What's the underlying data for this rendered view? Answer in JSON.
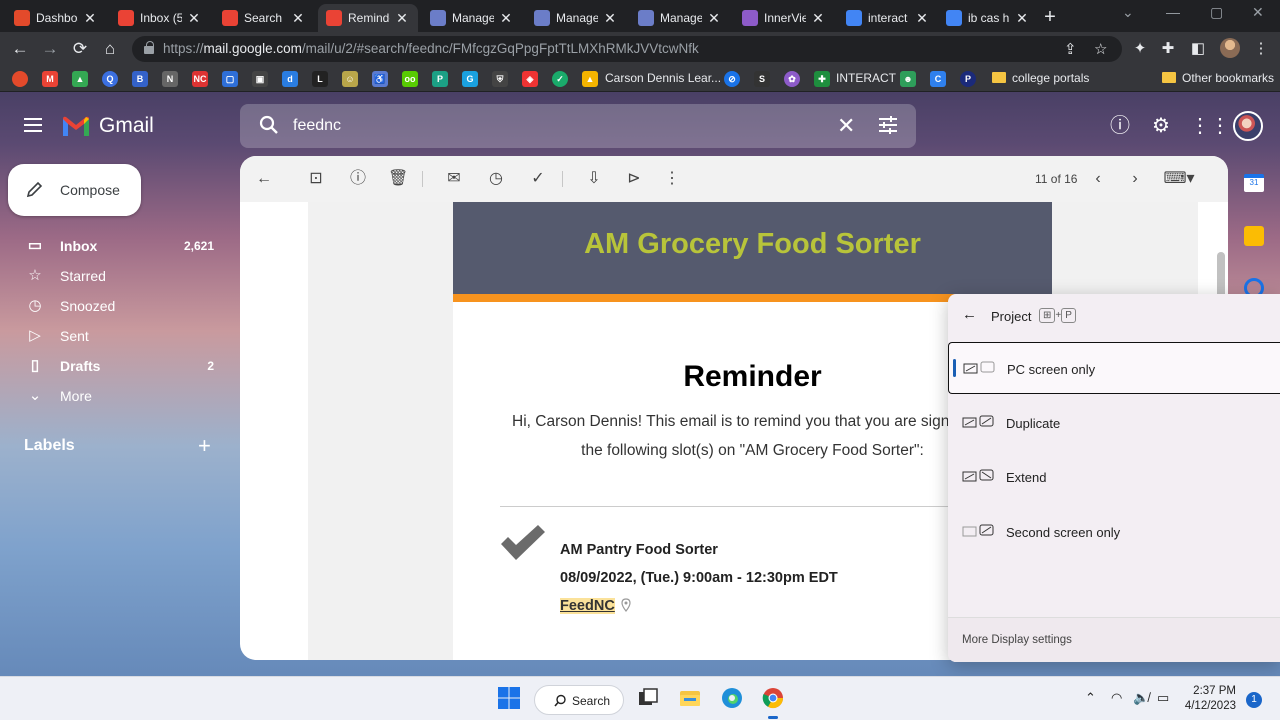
{
  "browser": {
    "tabs": [
      {
        "title": "Dashboa",
        "favicon": "canvas-icon",
        "color": "#e34a2b"
      },
      {
        "title": "Inbox (5",
        "favicon": "gmail-icon",
        "color": "#ea4335"
      },
      {
        "title": "Search r",
        "favicon": "gmail-icon",
        "color": "#ea4335"
      },
      {
        "title": "Reminde",
        "favicon": "gmail-icon",
        "color": "#ea4335",
        "active": true
      },
      {
        "title": "Manage",
        "favicon": "signup-icon",
        "color": "#6b7dc8"
      },
      {
        "title": "Manage",
        "favicon": "signup-icon",
        "color": "#6b7dc8"
      },
      {
        "title": "Manage",
        "favicon": "signup-icon",
        "color": "#6b7dc8"
      },
      {
        "title": "InnerVie",
        "favicon": "innerview-icon",
        "color": "#8d5bc9"
      },
      {
        "title": "interact",
        "favicon": "google-icon",
        "color": "#4285f4"
      },
      {
        "title": "ib cas h",
        "favicon": "google-icon",
        "color": "#4285f4"
      }
    ],
    "url_host": "mail.google.com",
    "url_prefix": "https://",
    "url_path": "/mail/u/2/#search/feednc/FMfcgzGqPpgFptTtLMXhRMkJVVtcwNfk",
    "bookmarks": {
      "carson": "Carson Dennis Lear...",
      "interact": "INTERACT",
      "college": "college portals",
      "other": "Other bookmarks"
    }
  },
  "gmail": {
    "brand": "Gmail",
    "search_query": "feednc",
    "compose_label": "Compose",
    "nav": [
      {
        "label": "Inbox",
        "count": "2,621",
        "icon": "inbox-icon",
        "bold": true
      },
      {
        "label": "Starred",
        "count": "",
        "icon": "star-icon"
      },
      {
        "label": "Snoozed",
        "count": "",
        "icon": "clock-icon"
      },
      {
        "label": "Sent",
        "count": "",
        "icon": "send-icon"
      },
      {
        "label": "Drafts",
        "count": "2",
        "icon": "draft-icon",
        "bold": true
      },
      {
        "label": "More",
        "count": "",
        "icon": "chevron-down-icon"
      }
    ],
    "labels_title": "Labels",
    "pager": "11 of 16"
  },
  "email": {
    "banner_title": "AM Grocery Food Sorter",
    "heading": "Reminder",
    "body_line1": "Hi, Carson Dennis! This email is to remind you that you are signed",
    "body_line2": "the following slot(s) on \"AM Grocery Food Sorter\":",
    "slot_name": "AM Pantry Food Sorter",
    "slot_time": "08/09/2022, (Tue.) 9:00am - 12:30pm EDT",
    "slot_location": "FeedNC",
    "colors": {
      "banner": "#555a6e",
      "banner_text": "#b8c43a",
      "stripe": "#f7931e"
    }
  },
  "project_flyout": {
    "title": "Project",
    "shortcut_key1": "⊞",
    "shortcut_plus": "+",
    "shortcut_key2": "P",
    "options": [
      {
        "label": "PC screen only",
        "selected": true
      },
      {
        "label": "Duplicate"
      },
      {
        "label": "Extend"
      },
      {
        "label": "Second screen only"
      }
    ],
    "footer": "More Display settings"
  },
  "taskbar": {
    "search_label": "Search",
    "time": "2:37 PM",
    "date": "4/12/2023",
    "notifications": "1"
  }
}
